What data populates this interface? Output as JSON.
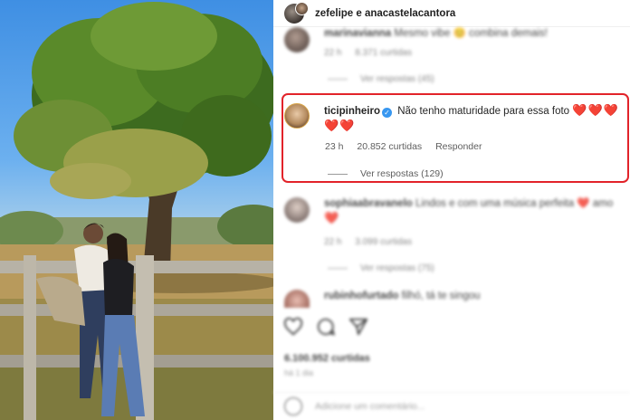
{
  "post": {
    "header_names": "zefelipe e anacastelacantora",
    "likes_text": "6.100.952 curtidas",
    "date_text": "há 1 dia",
    "add_comment_placeholder": "Adicione um comentário..."
  },
  "comments": [
    {
      "username": "marinavianna",
      "text": "Mesmo vibe 😊 combina demais!",
      "time": "22 h",
      "likes": "8.371 curtidas",
      "replies": "Ver respostas (45)",
      "blurred": true
    },
    {
      "username": "ticipinheiro",
      "verified": true,
      "text": "Não tenho maturidade para essa foto",
      "hearts_line1": "❤️❤️❤️",
      "hearts_line2": "❤️❤️",
      "time": "23 h",
      "likes": "20.852 curtidas",
      "reply_label": "Responder",
      "replies": "Ver respostas (129)",
      "blurred": false,
      "highlighted": true
    },
    {
      "username": "sophiaabravanelo",
      "text": "Lindos e com uma música perfeita ❤️ amo",
      "text_line2": "❤️",
      "time": "22 h",
      "likes": "3.099 curtidas",
      "replies": "Ver respostas (75)",
      "blurred": true
    },
    {
      "username": "rubinhofurtado",
      "text": "filhó, tá te singou",
      "blurred": true
    }
  ],
  "icons": [
    "heart-icon",
    "comment-icon",
    "share-icon",
    "emoji-icon"
  ],
  "colors": {
    "highlight_border": "#e2232a",
    "verified": "#3897f0",
    "heart": "#e0141e",
    "meta_text": "#737373"
  }
}
